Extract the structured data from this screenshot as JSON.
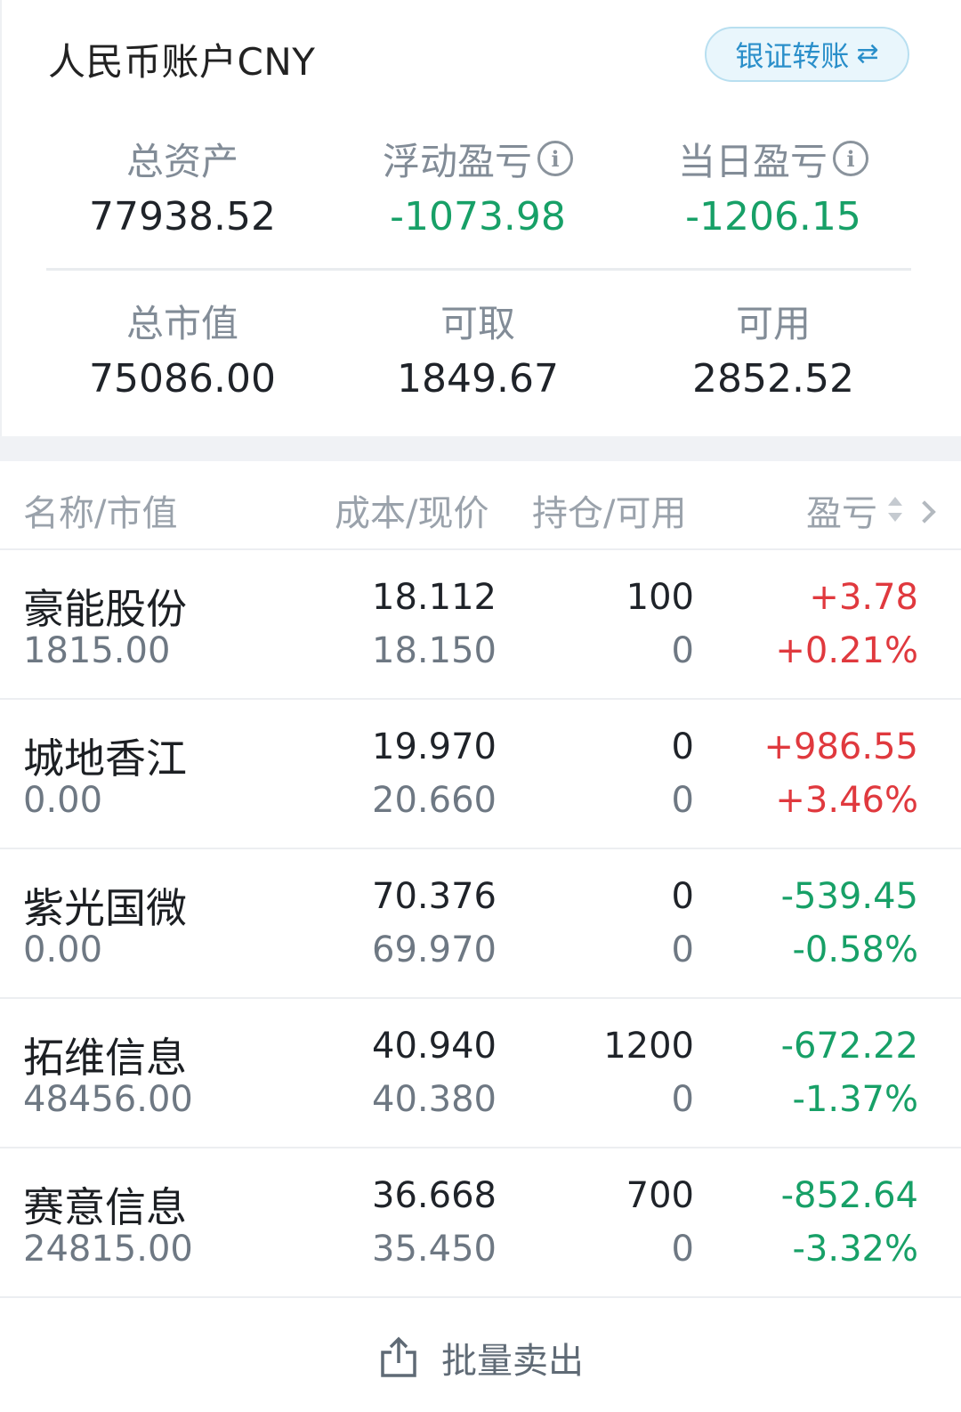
{
  "account": {
    "title": "人民币账户CNY",
    "transfer_label": "银证转账",
    "transfer_icon": "⇄"
  },
  "stats": {
    "total_assets": {
      "label": "总资产",
      "value": "77938.52"
    },
    "floating_pl": {
      "label": "浮动盈亏",
      "value": "-1073.98"
    },
    "daily_pl": {
      "label": "当日盈亏",
      "value": "-1206.15"
    },
    "total_market_value": {
      "label": "总市值",
      "value": "75086.00"
    },
    "withdrawable": {
      "label": "可取",
      "value": "1849.67"
    },
    "available": {
      "label": "可用",
      "value": "2852.52"
    }
  },
  "table": {
    "headers": {
      "name": "名称/市值",
      "cost": "成本/现价",
      "hold": "持仓/可用",
      "pl": "盈亏"
    },
    "rows": [
      {
        "name": "豪能股份",
        "market_value": "1815.00",
        "cost": "18.112",
        "price": "18.150",
        "hold": "100",
        "available": "0",
        "pl": "+3.78",
        "pl_pct": "+0.21%",
        "direction": "up"
      },
      {
        "name": "城地香江",
        "market_value": "0.00",
        "cost": "19.970",
        "price": "20.660",
        "hold": "0",
        "available": "0",
        "pl": "+986.55",
        "pl_pct": "+3.46%",
        "direction": "up"
      },
      {
        "name": "紫光国微",
        "market_value": "0.00",
        "cost": "70.376",
        "price": "69.970",
        "hold": "0",
        "available": "0",
        "pl": "-539.45",
        "pl_pct": "-0.58%",
        "direction": "down"
      },
      {
        "name": "拓维信息",
        "market_value": "48456.00",
        "cost": "40.940",
        "price": "40.380",
        "hold": "1200",
        "available": "0",
        "pl": "-672.22",
        "pl_pct": "-1.37%",
        "direction": "down"
      },
      {
        "name": "赛意信息",
        "market_value": "24815.00",
        "cost": "36.668",
        "price": "35.450",
        "hold": "700",
        "available": "0",
        "pl": "-852.64",
        "pl_pct": "-3.32%",
        "direction": "down"
      }
    ]
  },
  "batch_sell": {
    "label": "批量卖出",
    "icon": "share-icon"
  },
  "colors": {
    "up": "#e0393e",
    "down": "#17a067",
    "accent": "#2a8fca"
  }
}
